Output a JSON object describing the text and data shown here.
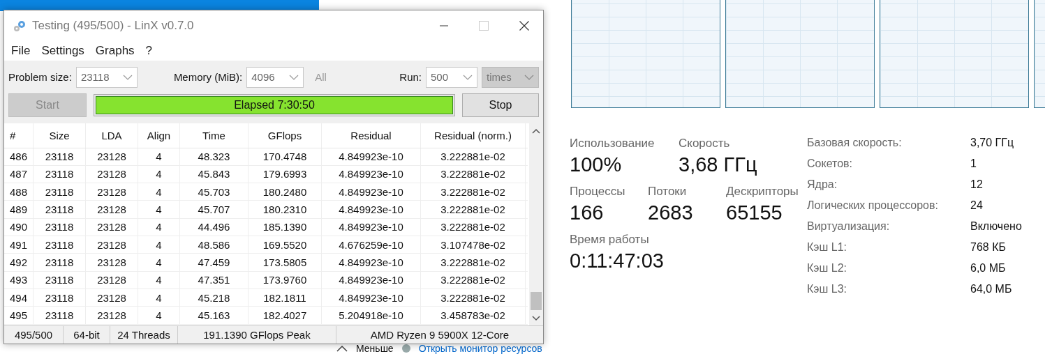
{
  "window": {
    "title": "Testing (495/500) - LinX v0.7.0"
  },
  "menu": [
    "File",
    "Settings",
    "Graphs",
    "?"
  ],
  "controls": {
    "problem_size": {
      "label": "Problem size:",
      "value": "23118"
    },
    "memory": {
      "label": "Memory (MiB):",
      "value": "4096"
    },
    "all_label": {
      "text": "All",
      "disabled": true
    },
    "run": {
      "label": "Run:",
      "value": "500"
    },
    "unit": {
      "value": "times",
      "disabled": true
    }
  },
  "start_button": {
    "label": "Start",
    "disabled": true
  },
  "progress": {
    "text": "Elapsed 7:30:50",
    "level": 1
  },
  "stop_button": {
    "label": "Stop",
    "disabled": false
  },
  "table": {
    "columns": [
      "#",
      "Size",
      "LDA",
      "Align",
      "Time",
      "GFlops",
      "Residual",
      "Residual (norm.)"
    ],
    "rows": [
      [
        "486",
        "23118",
        "23128",
        "4",
        "48.323",
        "170.4748",
        "4.849923e-10",
        "3.222881e-02"
      ],
      [
        "487",
        "23118",
        "23128",
        "4",
        "45.843",
        "179.6993",
        "4.849923e-10",
        "3.222881e-02"
      ],
      [
        "488",
        "23118",
        "23128",
        "4",
        "45.703",
        "180.2480",
        "4.849923e-10",
        "3.222881e-02"
      ],
      [
        "489",
        "23118",
        "23128",
        "4",
        "45.707",
        "180.2310",
        "4.849923e-10",
        "3.222881e-02"
      ],
      [
        "490",
        "23118",
        "23128",
        "4",
        "44.496",
        "185.1390",
        "4.849923e-10",
        "3.222881e-02"
      ],
      [
        "491",
        "23118",
        "23128",
        "4",
        "48.586",
        "169.5520",
        "4.676259e-10",
        "3.107478e-02"
      ],
      [
        "492",
        "23118",
        "23128",
        "4",
        "47.459",
        "173.5805",
        "4.849923e-10",
        "3.222881e-02"
      ],
      [
        "493",
        "23118",
        "23128",
        "4",
        "47.351",
        "173.9760",
        "4.849923e-10",
        "3.222881e-02"
      ],
      [
        "494",
        "23118",
        "23128",
        "4",
        "45.218",
        "182.1811",
        "4.849923e-10",
        "3.222881e-02"
      ],
      [
        "495",
        "23118",
        "23128",
        "4",
        "45.163",
        "182.4027",
        "5.204918e-10",
        "3.458783e-02"
      ]
    ]
  },
  "status_bar": [
    "495/500",
    "64-bit",
    "24 Threads",
    "191.1390 GFlops Peak",
    "AMD Ryzen 9 5900X 12-Core"
  ],
  "task_manager": {
    "stats": [
      {
        "label": "Использование",
        "value": "100%"
      },
      {
        "label": "Скорость",
        "value": "3,68 ГГц"
      }
    ],
    "stats2": [
      {
        "label": "Процессы",
        "value": "166"
      },
      {
        "label": "Потоки",
        "value": "2683"
      },
      {
        "label": "Дескрипторы",
        "value": "65155"
      }
    ],
    "uptime": {
      "label": "Время работы",
      "value": "0:11:47:03"
    },
    "details": [
      [
        "Базовая скорость:",
        "3,70 ГГц"
      ],
      [
        "Сокетов:",
        "1"
      ],
      [
        "Ядра:",
        "12"
      ],
      [
        "Логических процессоров:",
        "24"
      ],
      [
        "Виртуализация:",
        "Включено"
      ],
      [
        "Кэш L1:",
        "768 КБ"
      ],
      [
        "Кэш L2:",
        "6,0 МБ"
      ],
      [
        "Кэш L3:",
        "64,0 МБ"
      ]
    ],
    "footer": {
      "less": "Меньше",
      "link": "Открыть монитор ресурсов"
    }
  }
}
